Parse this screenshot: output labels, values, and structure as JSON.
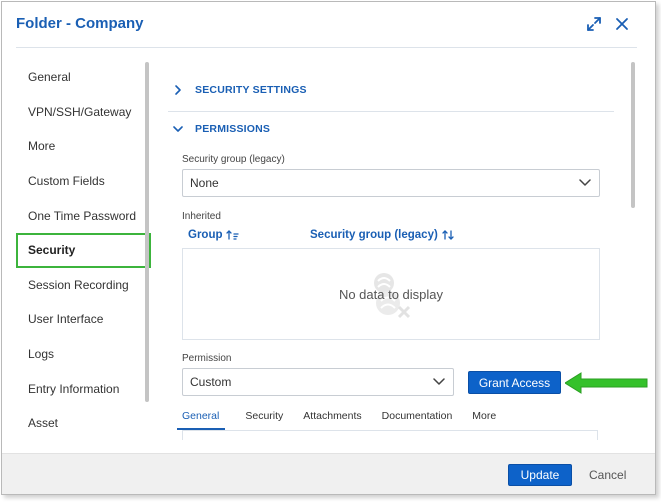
{
  "dialog": {
    "title": "Folder - Company",
    "expand_icon": "expand-arrows-icon",
    "close_icon": "close-icon"
  },
  "sidebar": {
    "items": [
      {
        "label": "General"
      },
      {
        "label": "VPN/SSH/Gateway"
      },
      {
        "label": "More"
      },
      {
        "label": "Custom Fields"
      },
      {
        "label": "One Time Password"
      },
      {
        "label": "Security",
        "active": true
      },
      {
        "label": "Session Recording"
      },
      {
        "label": "User Interface"
      },
      {
        "label": "Logs"
      },
      {
        "label": "Entry Information"
      },
      {
        "label": "Asset"
      }
    ]
  },
  "sections": {
    "security_settings": "SECURITY SETTINGS",
    "permissions": "PERMISSIONS"
  },
  "permissions": {
    "security_group_label": "Security group (legacy)",
    "security_group_value": "None",
    "inherited_label": "Inherited",
    "columns": [
      {
        "label": "Group"
      },
      {
        "label": "Security group (legacy)"
      }
    ],
    "empty_text": "No data to display",
    "permission_label": "Permission",
    "permission_value": "Custom",
    "grant_button": "Grant Access",
    "tabs": [
      "General",
      "Security",
      "Attachments",
      "Documentation",
      "More"
    ],
    "active_tab": "General"
  },
  "footer": {
    "update": "Update",
    "cancel": "Cancel"
  },
  "colors": {
    "accent": "#1a5fb4",
    "primary_button": "#0d62c9",
    "highlight_green": "#3cb43c"
  }
}
